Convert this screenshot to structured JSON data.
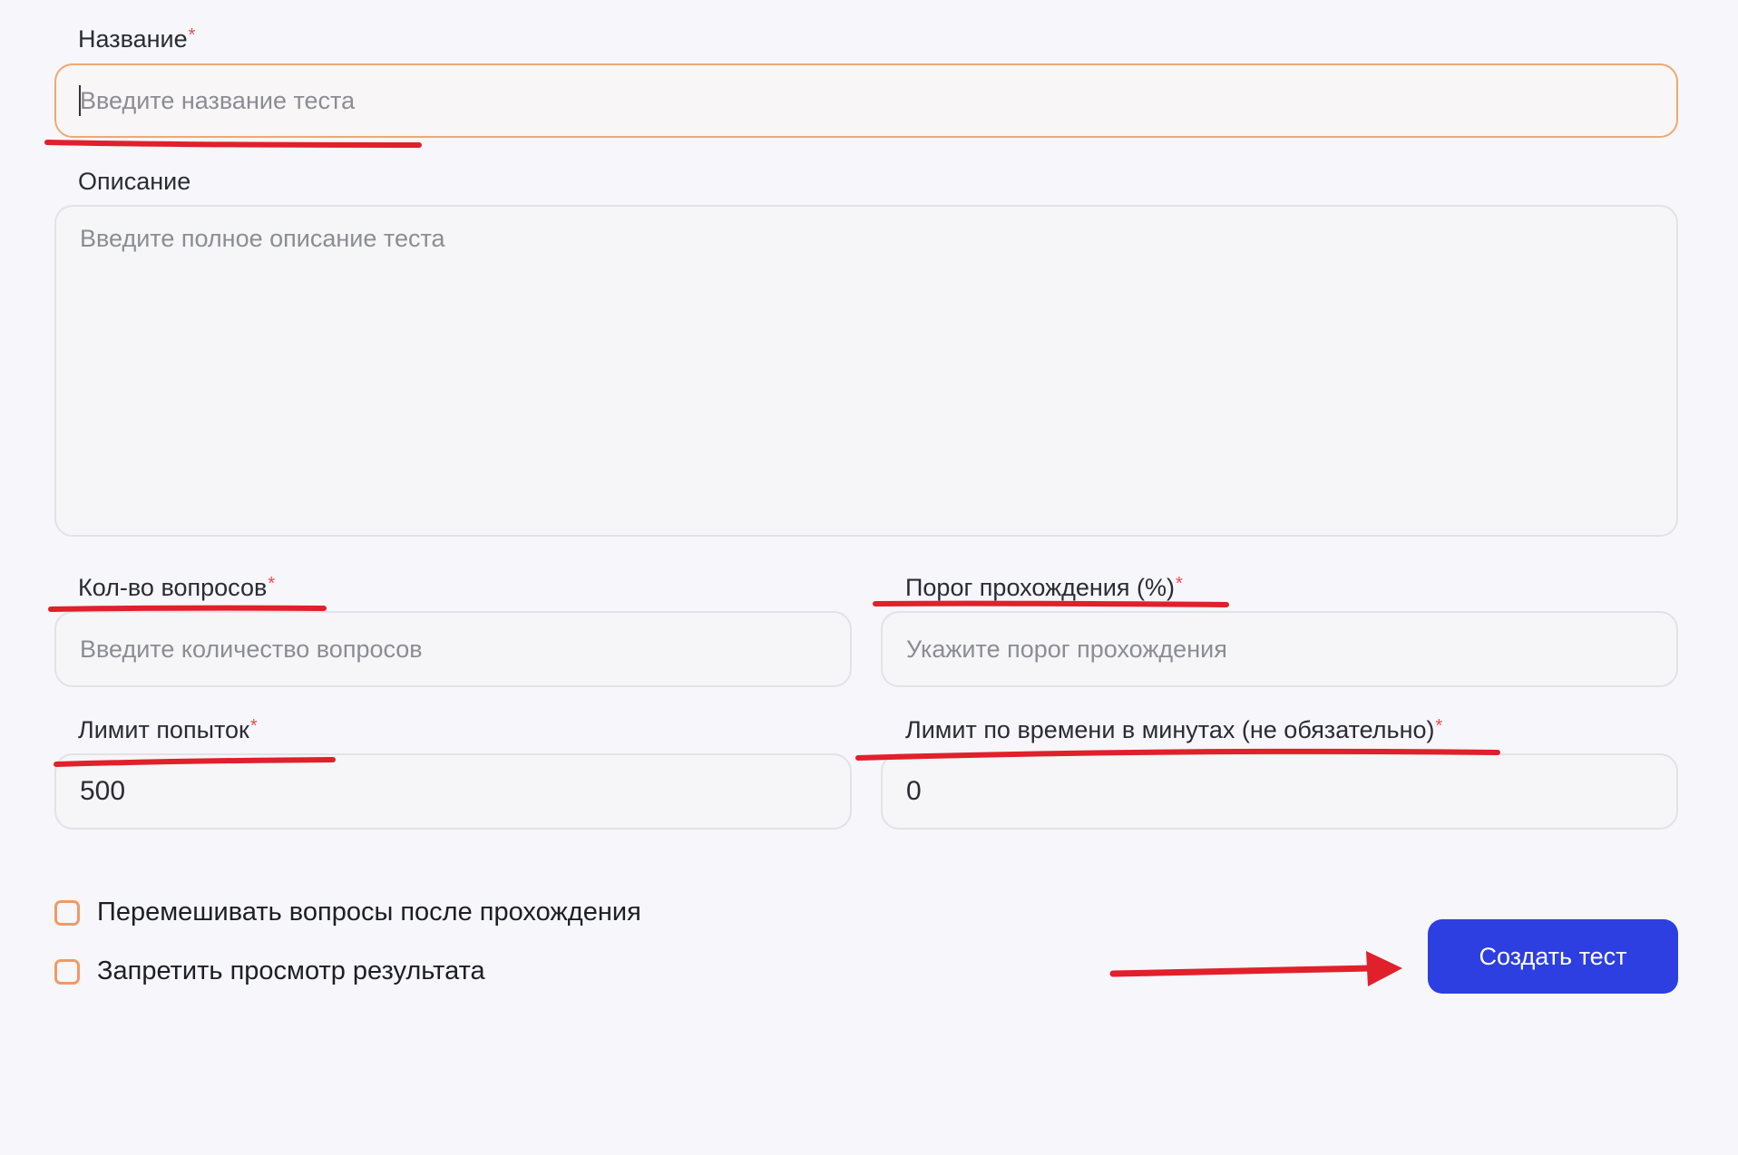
{
  "form": {
    "name": {
      "label": "Название",
      "required": "*",
      "placeholder": "Введите название теста"
    },
    "description": {
      "label": "Описание",
      "placeholder": "Введите полное описание теста"
    },
    "questions_count": {
      "label": "Кол-во вопросов",
      "required": "*",
      "placeholder": "Введите количество вопросов"
    },
    "pass_threshold": {
      "label": "Порог прохождения (%)",
      "required": "*",
      "placeholder": "Укажите порог прохождения"
    },
    "attempts_limit": {
      "label": "Лимит попыток",
      "required": "*",
      "value": "500"
    },
    "time_limit": {
      "label": "Лимит по времени в минутах (не обязательно)",
      "required": "*",
      "value": "0"
    },
    "shuffle_questions": {
      "label": "Перемешивать вопросы после прохождения",
      "checked": false
    },
    "hide_results": {
      "label": "Запретить просмотр результата",
      "checked": false
    },
    "submit_label": "Создать тест"
  },
  "colors": {
    "accent": "#2d3fe0",
    "focus_border": "#f0a872",
    "required_mark": "#ef4b4b",
    "annotation": "#e0202a"
  }
}
